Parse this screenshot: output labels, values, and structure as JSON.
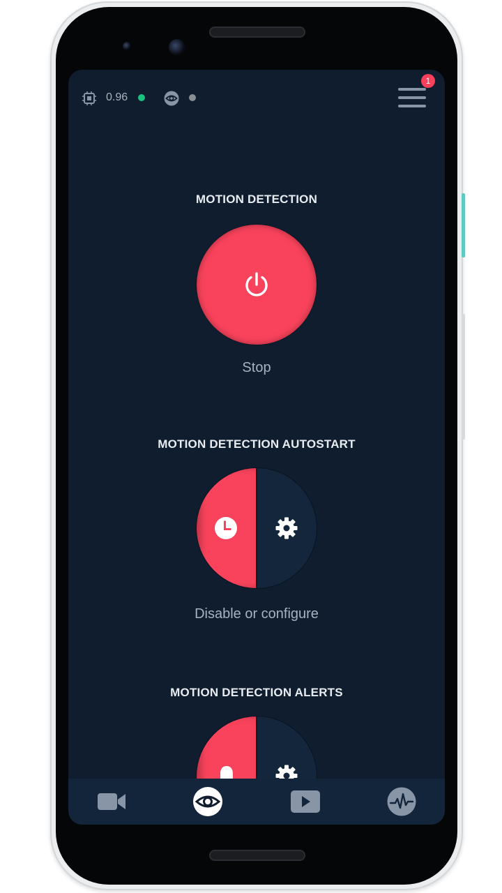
{
  "status": {
    "cpu_value": "0.96",
    "cpu_icon": "cpu-chip-icon",
    "cpu_dot_color": "#19c37d",
    "eye_icon": "eye-icon",
    "eye_dot_color": "#8a8f96",
    "menu_icon": "hamburger-menu-icon",
    "notification_count": "1"
  },
  "sections": {
    "motion": {
      "title": "MOTION DETECTION",
      "button_icon": "power-icon",
      "caption": "Stop"
    },
    "autostart": {
      "title": "MOTION DETECTION AUTOSTART",
      "left_icon": "clock-icon",
      "right_icon": "gear-icon",
      "caption": "Disable or configure"
    },
    "alerts": {
      "title": "MOTION DETECTION ALERTS",
      "left_icon": "bell-icon",
      "right_icon": "gear-icon"
    }
  },
  "tabs": [
    {
      "name": "camera",
      "icon": "video-camera-icon",
      "active": false
    },
    {
      "name": "motion",
      "icon": "eye-icon",
      "active": true
    },
    {
      "name": "recordings",
      "icon": "play-icon",
      "active": false
    },
    {
      "name": "activity",
      "icon": "pulse-icon",
      "active": false
    }
  ],
  "colors": {
    "accent": "#f9435c",
    "background": "#101d2e",
    "panel": "#13263b"
  }
}
